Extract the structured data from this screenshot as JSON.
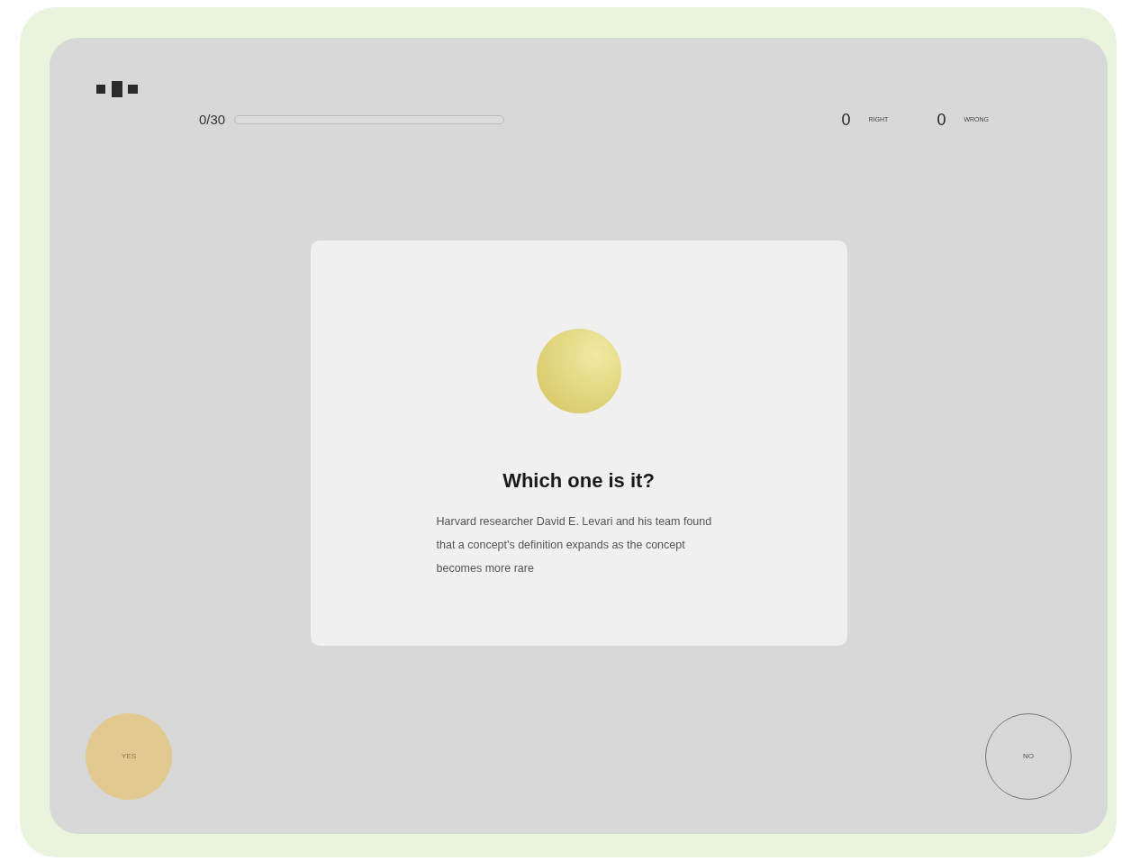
{
  "progress": {
    "label": "0/30",
    "level": 0
  },
  "scores": [
    {
      "value": "0",
      "label": "RIGHT"
    },
    {
      "value": "0",
      "label": "WRONG"
    }
  ],
  "card": {
    "title": "Which one is it?",
    "text": "Harvard researcher David E. Levari and his team found that a concept's definition expands as the concept becomes more rare"
  },
  "answers": [
    {
      "label": "YES",
      "kind": "filled"
    },
    {
      "label": "NO",
      "kind": "outline"
    }
  ]
}
